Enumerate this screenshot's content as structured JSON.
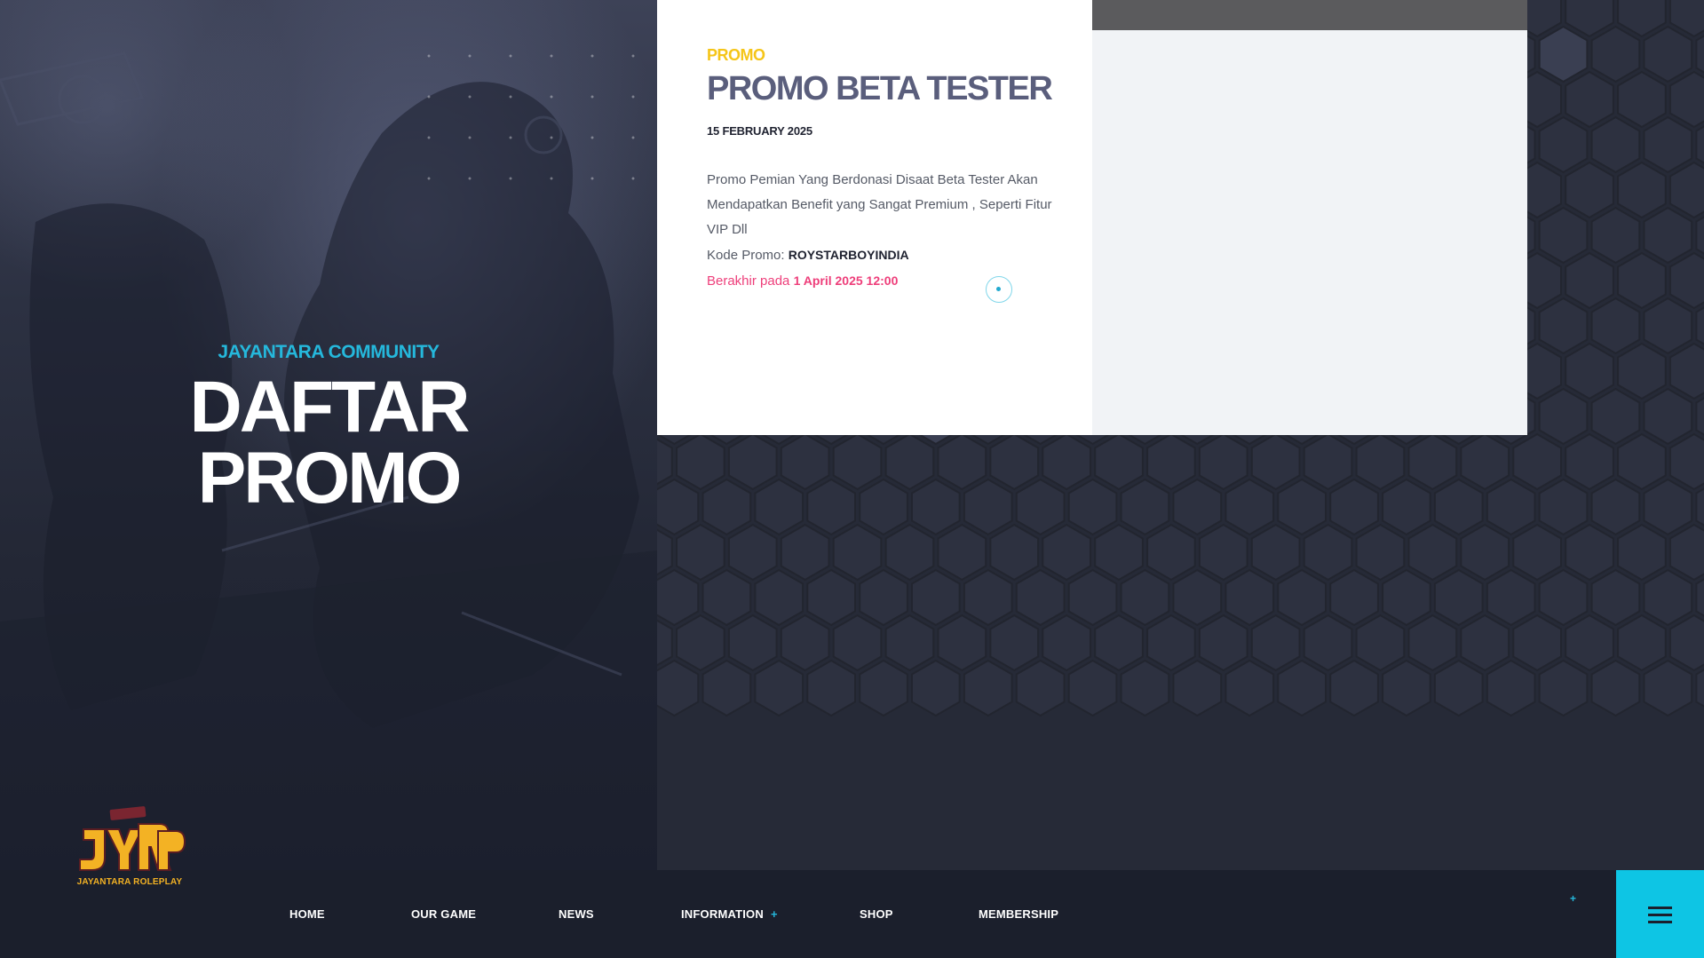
{
  "hero": {
    "kicker": "JAYANTARA COMMUNITY",
    "title_line1": "DAFTAR",
    "title_line2": "PROMO"
  },
  "promo_card": {
    "category": "PROMO",
    "title": "PROMO BETA TESTER",
    "date": "15 FEBRUARY 2025",
    "description": "Promo Pemian Yang Berdonasi Disaat Beta Tester Akan Mendapatkan Benefit yang Sangat Premium , Seperti Fitur VIP Dll",
    "code_label": "Kode Promo:",
    "code_value": "ROYSTARBOYINDIA",
    "end_label": "Berakhir pada",
    "end_value": "1 April 2025 12:00"
  },
  "logo": {
    "text": "JAYANTARA ROLEPLAY"
  },
  "nav": {
    "items": [
      {
        "label": "HOME"
      },
      {
        "label": "OUR GAME"
      },
      {
        "label": "NEWS"
      },
      {
        "label": "INFORMATION"
      },
      {
        "label": "SHOP"
      },
      {
        "label": "MEMBERSHIP"
      }
    ],
    "plus_symbol": "+"
  },
  "icons": {
    "menu": "hamburger-menu-icon",
    "action": "circle-dot-icon"
  },
  "colors": {
    "accent_cyan": "#0ec5e4",
    "promo_yellow": "#f5c518",
    "end_pink": "#ee3e7a",
    "title_slate": "#5a5e7c",
    "nav_bg": "#1b1f2c"
  }
}
